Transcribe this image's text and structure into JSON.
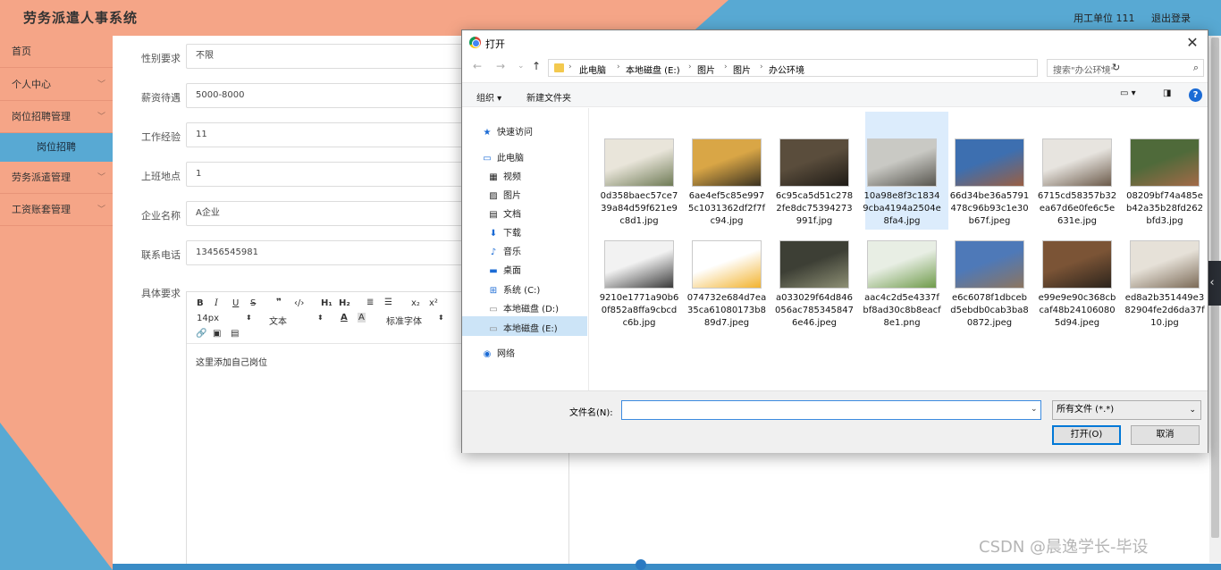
{
  "header": {
    "title": "劳务派遣人事系统",
    "user_label": "用工单位 111",
    "logout": "退出登录"
  },
  "sidebar": {
    "items": [
      {
        "label": "首页",
        "has_arrow": false
      },
      {
        "label": "个人中心",
        "has_arrow": true
      },
      {
        "label": "岗位招聘管理",
        "has_arrow": true
      },
      {
        "label": "劳务派遣管理",
        "has_arrow": true
      },
      {
        "label": "工资账套管理",
        "has_arrow": true
      }
    ],
    "active_sub": "岗位招聘"
  },
  "form": {
    "gender": {
      "label": "性别要求",
      "value": "不限"
    },
    "salary": {
      "label": "薪资待遇",
      "value": "5000-8000"
    },
    "experience": {
      "label": "工作经验",
      "value": "11"
    },
    "location": {
      "label": "上班地点",
      "value": "1"
    },
    "company": {
      "label": "企业名称",
      "value": "A企业"
    },
    "phone": {
      "label": "联系电话",
      "value": "13456545981"
    },
    "detail": {
      "label": "具体要求"
    }
  },
  "editor": {
    "font_size": "14px",
    "text_style": "文本",
    "font_family": "标准字体",
    "content": "这里添加自己岗位"
  },
  "dialog": {
    "title": "打开",
    "breadcrumbs": [
      "此电脑",
      "本地磁盘 (E:)",
      "图片",
      "图片",
      "办公环境"
    ],
    "search_placeholder": "搜索\"办公环境\"",
    "organize": "组织 ▾",
    "new_folder": "新建文件夹",
    "nav": {
      "quick_access": "快速访问",
      "this_pc": "此电脑",
      "videos": "视频",
      "pictures": "图片",
      "documents": "文档",
      "downloads": "下载",
      "music": "音乐",
      "desktop": "桌面",
      "drive_c": "系统 (C:)",
      "drive_d": "本地磁盘 (D:)",
      "drive_e": "本地磁盘 (E:)",
      "network": "网络"
    },
    "files": [
      {
        "name": "0d358baec57ce739a84d59f621e9c8d1.jpg",
        "colors": [
          "#e9e5da",
          "#6f7b56"
        ]
      },
      {
        "name": "6ae4ef5c85e9975c1031362df2f7fc94.jpg",
        "colors": [
          "#d9a646",
          "#3b3220"
        ]
      },
      {
        "name": "6c95ca5d51c2782fe8dc75394273991f.jpg",
        "colors": [
          "#5a4d3c",
          "#1f1b16"
        ]
      },
      {
        "name": "10a98e8f3c18349cba4194a2504e8fa4.jpg",
        "colors": [
          "#c9c9c4",
          "#58564f"
        ]
      },
      {
        "name": "66d34be36a5791478c96b93c1e30b67f.jpeg",
        "colors": [
          "#3d6fb0",
          "#9a5f43"
        ]
      },
      {
        "name": "6715cd58357b32ea67d6e0fe6c5e631e.jpg",
        "colors": [
          "#e7e4df",
          "#6b5a4a"
        ]
      },
      {
        "name": "08209bf74a485eb42a35b28fd262bfd3.jpg",
        "colors": [
          "#4f6a3a",
          "#a36a48"
        ]
      },
      {
        "name": "9210e1771a90b60f852a8ffa9cbcdc6b.jpg",
        "colors": [
          "#f2f2f2",
          "#3a3a3a"
        ]
      },
      {
        "name": "074732e684d7ea35ca61080173b889d7.jpeg",
        "colors": [
          "#ffffff",
          "#f2b32f"
        ]
      },
      {
        "name": "a033029f64d846056ac7853458476e46.jpeg",
        "colors": [
          "#3d3f35",
          "#8d8f74"
        ]
      },
      {
        "name": "aac4c2d5e4337fbf8ad30c8b8eacf8e1.png",
        "colors": [
          "#e8eee4",
          "#6f9b4b"
        ]
      },
      {
        "name": "e6c6078f1dbcebd5ebdb0cab3ba80872.jpeg",
        "colors": [
          "#4e79b8",
          "#8c7560"
        ]
      },
      {
        "name": "e99e9e90c368cbcaf48b241060805d94.jpeg",
        "colors": [
          "#7b5436",
          "#2c241c"
        ]
      },
      {
        "name": "ed8a2b351449e382904fe2d6da37f10.jpg",
        "colors": [
          "#e6e1d8",
          "#7c6b58"
        ]
      }
    ],
    "filename_label": "文件名(N):",
    "filename_value": "",
    "filetype": "所有文件 (*.*)",
    "open_button": "打开(O)",
    "cancel_button": "取消"
  },
  "watermark": "CSDN @晨逸学长-毕设",
  "colors": {
    "salmon": "#f5a587",
    "blue": "#58a9d3",
    "dialog_selection": "#dcecfc"
  }
}
